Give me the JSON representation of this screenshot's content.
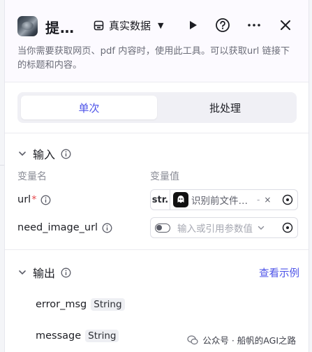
{
  "header": {
    "title": "提…",
    "data_mode_label": "真实数据",
    "description": "当你需要获取网页、pdf 内容时，使用此工具。可以获取url 链接下的标题和内容。"
  },
  "tabs": [
    {
      "label": "单次",
      "active": true
    },
    {
      "label": "批处理",
      "active": false
    }
  ],
  "input_section": {
    "title": "输入",
    "col_name": "变量名",
    "col_value": "变量值",
    "params": [
      {
        "name": "url",
        "required_mark": "*",
        "type_tag": "str.",
        "ref_text": "识别前文件…",
        "ref_dash": "-",
        "ref_clear": "×"
      },
      {
        "name": "need_image_url",
        "placeholder": "输入或引用参数值"
      }
    ]
  },
  "output_section": {
    "title": "输出",
    "view_example": "查看示例",
    "fields": [
      {
        "name": "error_msg",
        "type": "String"
      },
      {
        "name": "message",
        "type": "String"
      }
    ]
  },
  "watermark": {
    "text": "公众号 · 船帆的AGI之路"
  },
  "colors": {
    "accent": "#4d53e8",
    "required": "#e5484d",
    "header_bg": "#fcfaff"
  }
}
